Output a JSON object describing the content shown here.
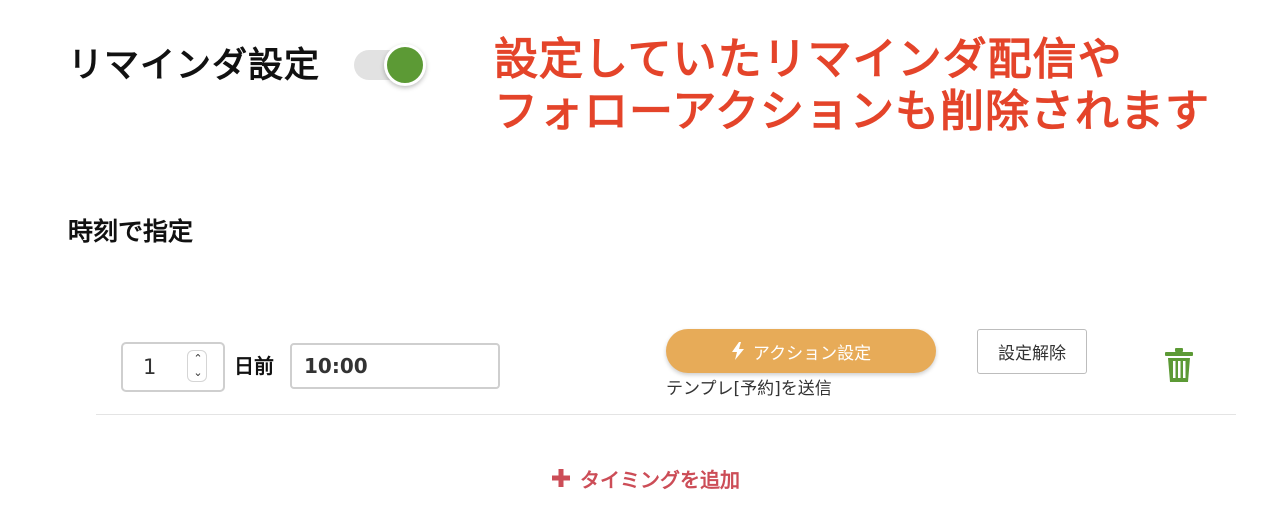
{
  "reminder": {
    "title": "リマインダ設定",
    "toggle_state": "on",
    "toggle_color": "#5c9a35"
  },
  "warning": {
    "line1": "設定していたリマインダ配信や",
    "line2": "フォローアクションも削除されます",
    "color": "#e4442a"
  },
  "section": {
    "heading": "時刻で指定"
  },
  "timing_row": {
    "day_value": "1",
    "day_unit": "日前",
    "time_value": "10:00",
    "action_button_label": "アクション設定",
    "action_button_icon": "lightning-bolt-icon",
    "action_button_color": "#e7ab58",
    "template_note": "テンプレ[予約]を送信",
    "cancel_button_label": "設定解除",
    "delete_icon": "trash-icon",
    "delete_icon_color": "#5c9a35"
  },
  "add_timing": {
    "label": "タイミングを追加",
    "icon": "plus-icon",
    "color": "#cc4d57"
  }
}
